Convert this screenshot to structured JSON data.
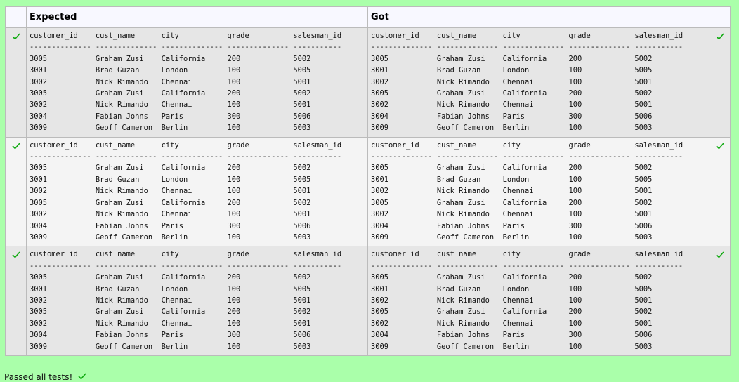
{
  "header": {
    "expected": "Expected",
    "got": "Got"
  },
  "tests": [
    {
      "expected": "customer_id    cust_name      city           grade          salesman_id\n-------------- -------------- -------------- -------------- -----------\n3005           Graham Zusi    California     200            5002\n3001           Brad Guzan     London         100            5005\n3002           Nick Rimando   Chennai        100            5001\n3005           Graham Zusi    California     200            5002\n3002           Nick Rimando   Chennai        100            5001\n3004           Fabian Johns   Paris          300            5006\n3009           Geoff Cameron  Berlin         100            5003",
      "got": "customer_id    cust_name      city           grade          salesman_id\n-------------- -------------- -------------- -------------- -----------\n3005           Graham Zusi    California     200            5002\n3001           Brad Guzan     London         100            5005\n3002           Nick Rimando   Chennai        100            5001\n3005           Graham Zusi    California     200            5002\n3002           Nick Rimando   Chennai        100            5001\n3004           Fabian Johns   Paris          300            5006\n3009           Geoff Cameron  Berlin         100            5003"
    },
    {
      "expected": "customer_id    cust_name      city           grade          salesman_id\n-------------- -------------- -------------- -------------- -----------\n3005           Graham Zusi    California     200            5002\n3001           Brad Guzan     London         100            5005\n3002           Nick Rimando   Chennai        100            5001\n3005           Graham Zusi    California     200            5002\n3002           Nick Rimando   Chennai        100            5001\n3004           Fabian Johns   Paris          300            5006\n3009           Geoff Cameron  Berlin         100            5003",
      "got": "customer_id    cust_name      city           grade          salesman_id\n-------------- -------------- -------------- -------------- -----------\n3005           Graham Zusi    California     200            5002\n3001           Brad Guzan     London         100            5005\n3002           Nick Rimando   Chennai        100            5001\n3005           Graham Zusi    California     200            5002\n3002           Nick Rimando   Chennai        100            5001\n3004           Fabian Johns   Paris          300            5006\n3009           Geoff Cameron  Berlin         100            5003"
    },
    {
      "expected": "customer_id    cust_name      city           grade          salesman_id\n-------------- -------------- -------------- -------------- -----------\n3005           Graham Zusi    California     200            5002\n3001           Brad Guzan     London         100            5005\n3002           Nick Rimando   Chennai        100            5001\n3005           Graham Zusi    California     200            5002\n3002           Nick Rimando   Chennai        100            5001\n3004           Fabian Johns   Paris          300            5006\n3009           Geoff Cameron  Berlin         100            5003",
      "got": "customer_id    cust_name      city           grade          salesman_id\n-------------- -------------- -------------- -------------- -----------\n3005           Graham Zusi    California     200            5002\n3001           Brad Guzan     London         100            5005\n3002           Nick Rimando   Chennai        100            5001\n3005           Graham Zusi    California     200            5002\n3002           Nick Rimando   Chennai        100            5001\n3004           Fabian Johns   Paris          300            5006\n3009           Geoff Cameron  Berlin         100            5003"
    }
  ],
  "footer": {
    "text": "Passed all tests!"
  },
  "icons": {
    "pass": "check-icon"
  },
  "colors": {
    "background": "#aaffaa",
    "check": "#11aa11",
    "header_bg": "#f8f8ff"
  }
}
